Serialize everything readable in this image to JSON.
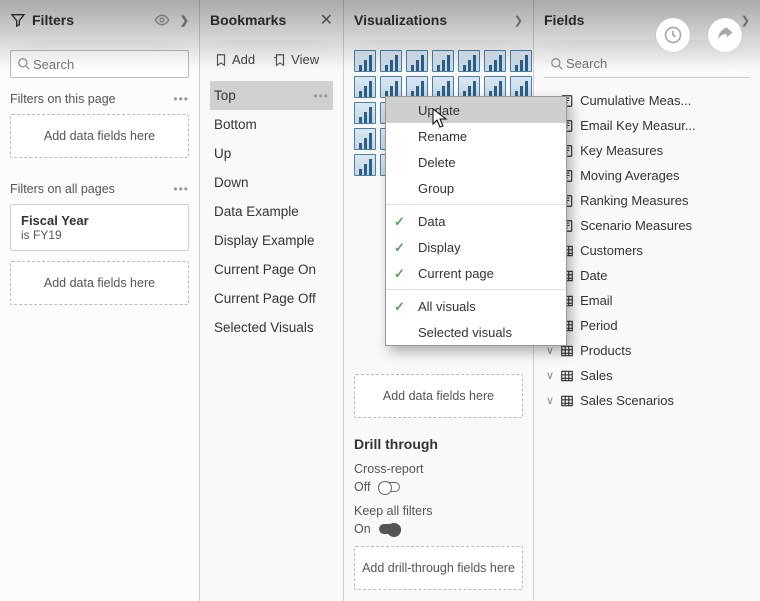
{
  "filters": {
    "title": "Filters",
    "search_placeholder": "Search",
    "page_label": "Filters on this page",
    "all_label": "Filters on all pages",
    "dropzone": "Add data fields here",
    "card": {
      "name": "Fiscal Year",
      "value": "is FY19"
    }
  },
  "bookmarks": {
    "title": "Bookmarks",
    "add": "Add",
    "view": "View",
    "items": [
      "Top",
      "Bottom",
      "Up",
      "Down",
      "Data Example",
      "Display Example",
      "Current Page On",
      "Current Page Off",
      "Selected Visuals"
    ],
    "selected_index": 0
  },
  "viz": {
    "title": "Visualizations",
    "dropzone": "Add data fields here",
    "drill_title": "Drill through",
    "cross_label": "Cross-report",
    "cross_value": "Off",
    "keep_label": "Keep all filters",
    "keep_value": "On",
    "drill_dropzone": "Add drill-through fields here"
  },
  "fields": {
    "title": "Fields",
    "search_placeholder": "Search",
    "items": [
      {
        "name": "Cumulative Meas...",
        "type": "measure"
      },
      {
        "name": "Email Key Measur...",
        "type": "measure"
      },
      {
        "name": "Key Measures",
        "type": "measure"
      },
      {
        "name": "Moving Averages",
        "type": "measure"
      },
      {
        "name": "Ranking Measures",
        "type": "measure"
      },
      {
        "name": "Scenario Measures",
        "type": "measure"
      },
      {
        "name": "Customers",
        "type": "table"
      },
      {
        "name": "Date",
        "type": "table"
      },
      {
        "name": "Email",
        "type": "table"
      },
      {
        "name": "Period",
        "type": "table"
      },
      {
        "name": "Products",
        "type": "table"
      },
      {
        "name": "Sales",
        "type": "table"
      },
      {
        "name": "Sales Scenarios",
        "type": "table"
      }
    ]
  },
  "ctx": {
    "items": [
      {
        "label": "Update",
        "hover": true
      },
      {
        "label": "Rename"
      },
      {
        "label": "Delete"
      },
      {
        "label": "Group"
      },
      {
        "sep": true
      },
      {
        "label": "Data",
        "checked": true
      },
      {
        "label": "Display",
        "checked": true
      },
      {
        "label": "Current page",
        "checked": true
      },
      {
        "sep": true
      },
      {
        "label": "All visuals",
        "checked": true
      },
      {
        "label": "Selected visuals"
      }
    ]
  }
}
